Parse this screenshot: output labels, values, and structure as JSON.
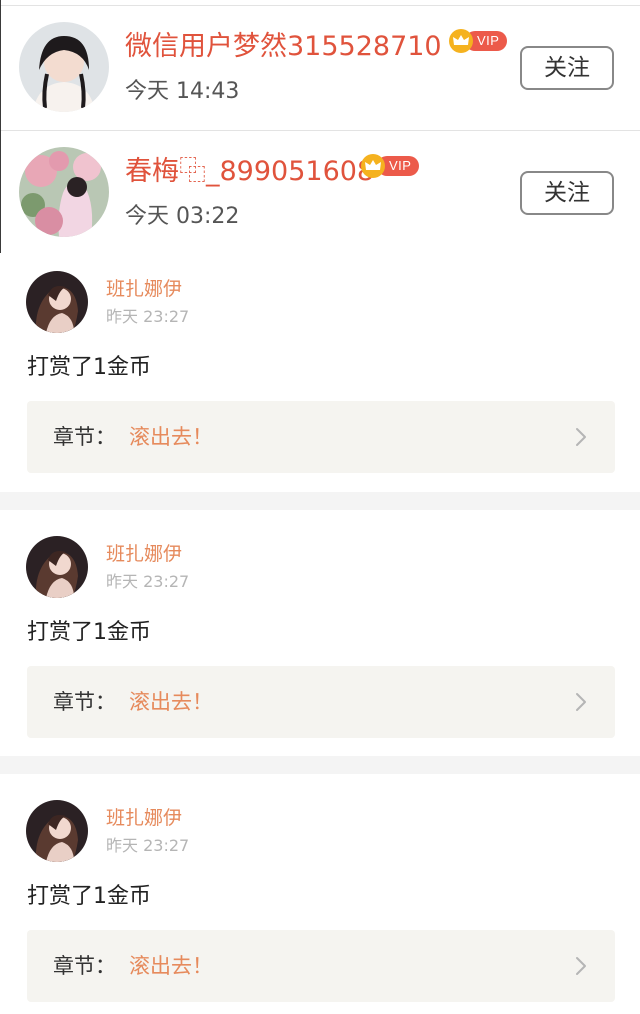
{
  "follows": [
    {
      "username": "微信用户梦然315528710",
      "vip_label": "VIP",
      "time": "今天 14:43",
      "follow_label": "关注"
    },
    {
      "username": "春梅⿻_899051608",
      "vip_label": "VIP",
      "time": "今天 03:22",
      "follow_label": "关注"
    }
  ],
  "rewards": [
    {
      "username": "班扎娜伊",
      "time": "昨天 23:27",
      "text": "打赏了1金币",
      "chapter_label": "章节：",
      "chapter_title": "滚出去！"
    },
    {
      "username": "班扎娜伊",
      "time": "昨天 23:27",
      "text": "打赏了1金币",
      "chapter_label": "章节：",
      "chapter_title": "滚出去！"
    },
    {
      "username": "班扎娜伊",
      "time": "昨天 23:27",
      "text": "打赏了1金币",
      "chapter_label": "章节：",
      "chapter_title": "滚出去！"
    }
  ],
  "icons": {
    "vip_badge": "crown-icon",
    "chapter_arrow": "chevron-right-icon"
  },
  "colors": {
    "username_red": "#e0533c",
    "accent_orange": "#e68a5c",
    "vip_red": "#ec5a4a",
    "crown_gold": "#f5b21f",
    "chapter_bg": "#f5f4f0",
    "separator_gray": "#f4f4f4"
  }
}
